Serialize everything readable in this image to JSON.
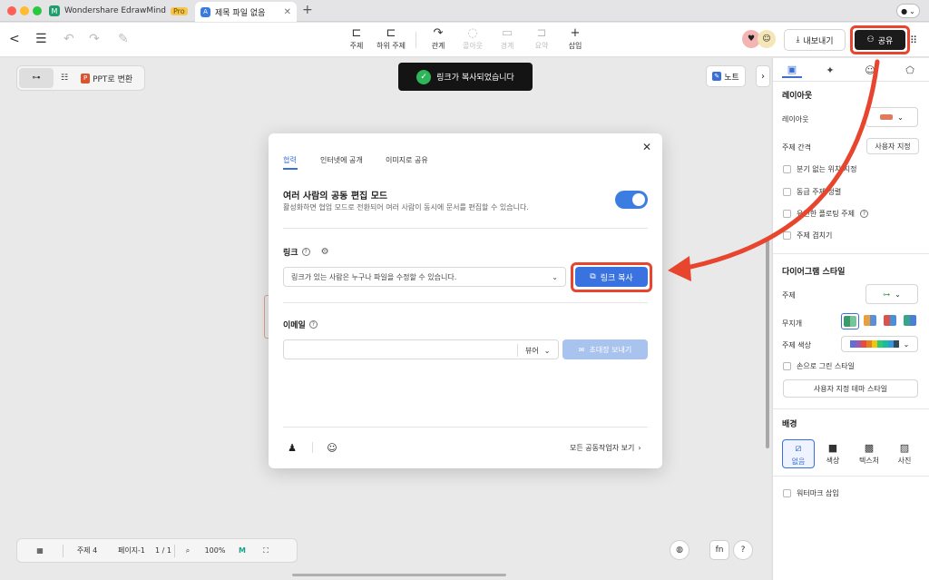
{
  "titlebar": {
    "app_tab": "Wondershare EdrawMind",
    "pro_badge": "Pro",
    "doc_tab": "제목 파일 없음"
  },
  "toolbar": {
    "tools": [
      {
        "label": "주제",
        "icon": "topic-icon"
      },
      {
        "label": "하위 주제",
        "icon": "subtopic-icon"
      },
      {
        "label": "관계",
        "icon": "relationship-icon"
      },
      {
        "label": "콜아웃",
        "icon": "callout-icon"
      },
      {
        "label": "경계",
        "icon": "boundary-icon"
      },
      {
        "label": "요약",
        "icon": "summary-icon"
      },
      {
        "label": "삽입",
        "icon": "insert-icon"
      }
    ],
    "export_label": "내보내기",
    "share_label": "공유"
  },
  "canvas": {
    "ppt_label": "PPT로 변환",
    "toast": "링크가 복사되었습니다",
    "note_label": "노트"
  },
  "statusbar": {
    "topic_count": "주제 4",
    "page_label": "페이지-1",
    "page_num": "1 / 1",
    "zoom": "100%"
  },
  "modal": {
    "tabs": [
      "협력",
      "인터넷에 공개",
      "이미지로 공유"
    ],
    "active_tab": 0,
    "coedit_title": "여러 사람의 공동 편집 모드",
    "coedit_desc": "활성화하면 협업 모드로 전환되어 여러 사람이 동시에 문서를 편집할 수 있습니다.",
    "coedit_enabled": true,
    "link_label": "링크",
    "link_permission": "링크가 있는 사람은 누구나 파일을 수정할 수 있습니다.",
    "copy_link_label": "링크 복사",
    "email_label": "이메일",
    "email_value": "",
    "email_role": "뷰어",
    "invite_label": "초대장 보내기",
    "all_collaborators": "모든 공동작업자 보기"
  },
  "panel": {
    "layout_title": "레이아웃",
    "layout_label": "레이아웃",
    "spacing_label": "주제 간격",
    "spacing_value": "사용자 지정",
    "checks1": [
      {
        "label": "분기 없는 위치 지정",
        "checked": false
      },
      {
        "label": "동급 주제 정렬",
        "checked": false
      },
      {
        "label": "유연한 플로팅 주제",
        "checked": false
      },
      {
        "label": "주제 겹치기",
        "checked": false
      }
    ],
    "diagram_style_title": "다이어그램 스타일",
    "topic_label": "주제",
    "pattern_label": "무지개",
    "topic_color_label": "주제 색상",
    "hand_drawn_label": "손으로 그린 스타일",
    "custom_theme_label": "사용자 지정 테마 스타일",
    "background_title": "배경",
    "bg_options": [
      "없음",
      "색상",
      "텍스처",
      "사진"
    ],
    "bg_active": 0,
    "watermark_label": "워터마크 삽입",
    "colors": {
      "accent": "#3b6fd6",
      "annotation": "#e8452f"
    }
  }
}
